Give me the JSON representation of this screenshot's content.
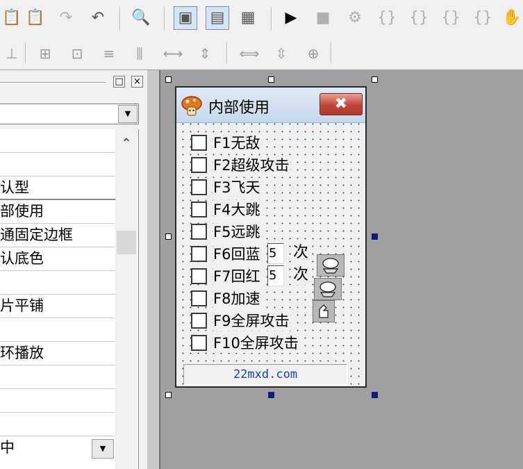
{
  "toolbar_top": {
    "buttons": [
      {
        "icon": "paste-icon",
        "glyph": "📋"
      },
      {
        "icon": "paste-special-icon",
        "glyph": "📋"
      },
      {
        "icon": "redo-icon",
        "glyph": "↷"
      },
      {
        "icon": "undo-icon",
        "glyph": "↶"
      },
      {
        "icon": "find-icon",
        "glyph": "🔍"
      },
      {
        "icon": "layout-left-icon",
        "glyph": "▣"
      },
      {
        "icon": "layout-top-icon",
        "glyph": "▤"
      },
      {
        "icon": "layout-grid-icon",
        "glyph": "▦"
      },
      {
        "icon": "run-icon",
        "glyph": "▶"
      },
      {
        "icon": "stop-icon",
        "glyph": "■"
      },
      {
        "icon": "compile-icon",
        "glyph": "⚙"
      },
      {
        "icon": "step-into-icon",
        "glyph": "{}"
      },
      {
        "icon": "step-over-icon",
        "glyph": "{}"
      },
      {
        "icon": "step-out-icon",
        "glyph": "{}"
      },
      {
        "icon": "run-to-cursor-icon",
        "glyph": "{}"
      },
      {
        "icon": "hand-icon",
        "glyph": "✋"
      }
    ]
  },
  "toolbar_align": {
    "buttons": [
      {
        "icon": "align-bottom-icon",
        "glyph": "⊥"
      },
      {
        "icon": "center-horizontal-icon",
        "glyph": "⊞"
      },
      {
        "icon": "center-vertical-icon",
        "glyph": "⊡"
      },
      {
        "icon": "align-top-edge-icon",
        "glyph": "≡"
      },
      {
        "icon": "align-middle-icon",
        "glyph": "⫼"
      },
      {
        "icon": "space-horizontal-icon",
        "glyph": "⟷"
      },
      {
        "icon": "space-vertical-icon",
        "glyph": "⇕"
      },
      {
        "icon": "same-width-icon",
        "glyph": "⟺"
      },
      {
        "icon": "same-height-icon",
        "glyph": "⇳"
      },
      {
        "icon": "same-size-icon",
        "glyph": "⊕"
      }
    ]
  },
  "panel": {
    "pin_label": "□",
    "close_label": "×",
    "combo_arrow": "▼",
    "scroll_up": "⌃",
    "rows": [
      "",
      "",
      "认型",
      "部使用",
      "通固定边框",
      "认底色",
      "",
      "片平铺",
      "",
      "环播放",
      "",
      "",
      "",
      ""
    ],
    "last_row_value": "中"
  },
  "form": {
    "title": "内部使用",
    "close_label": "✖",
    "checkboxes": [
      {
        "label": "F1无敌"
      },
      {
        "label": "F2超级攻击"
      },
      {
        "label": "F3飞天"
      },
      {
        "label": "F4大跳"
      },
      {
        "label": "F5远跳"
      },
      {
        "label": "F6回蓝"
      },
      {
        "label": "F7回红"
      },
      {
        "label": "F8加速"
      },
      {
        "label": "F9全屏攻击"
      },
      {
        "label": "F10全屏攻击"
      }
    ],
    "mana_count": "5",
    "health_count": "5",
    "times_label": "次",
    "footer": "22mxd.com"
  }
}
